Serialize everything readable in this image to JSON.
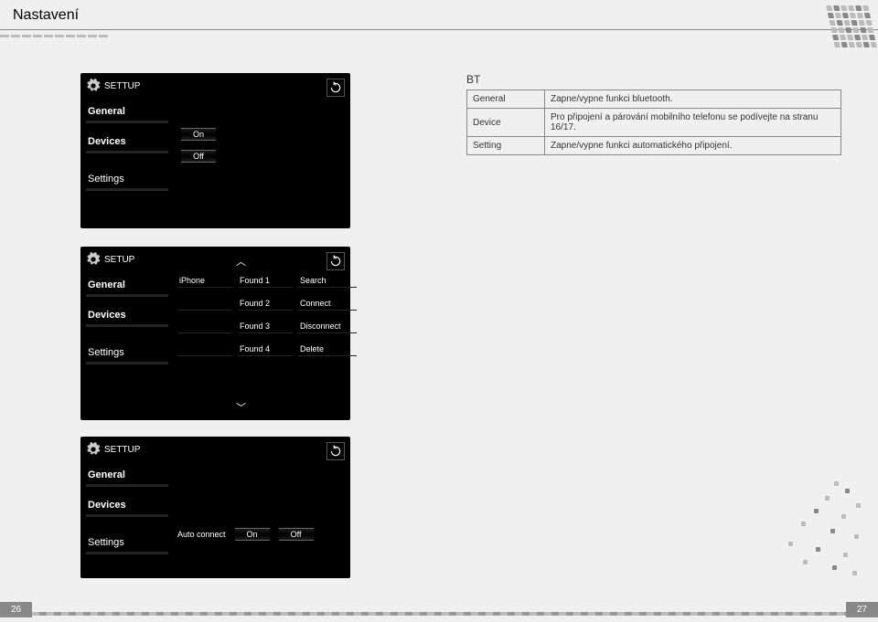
{
  "page_title": "Nastavení",
  "bt": {
    "heading": "BT",
    "rows": [
      {
        "k": "General",
        "v": "Zapne/vypne funkci bluetooth."
      },
      {
        "k": "Device",
        "v": "Pro připojení a párování mobilního telefonu se podívejte na stranu 16/17."
      },
      {
        "k": "Setting",
        "v": "Zapne/vypne funkci automatického připojení."
      }
    ]
  },
  "panel1": {
    "setup_label": "SETTUP",
    "side": [
      "General",
      "Devices",
      "Settings"
    ],
    "on": "On",
    "off": "Off"
  },
  "panel2": {
    "setup_label": "SETUP",
    "side": [
      "General",
      "Devices",
      "Settings"
    ],
    "col1": [
      "iPhone",
      "",
      "",
      ""
    ],
    "col2": [
      "Found 1",
      "Found 2",
      "Found 3",
      "Found 4"
    ],
    "col3": [
      "Search",
      "Connect",
      "Disconnect",
      "Delete"
    ]
  },
  "panel3": {
    "setup_label": "SETTUP",
    "side": [
      "General",
      "Devices",
      "Settings"
    ],
    "row_label": "Auto connect",
    "on": "On",
    "off": "Off"
  },
  "page_left": "26",
  "page_right": "27"
}
